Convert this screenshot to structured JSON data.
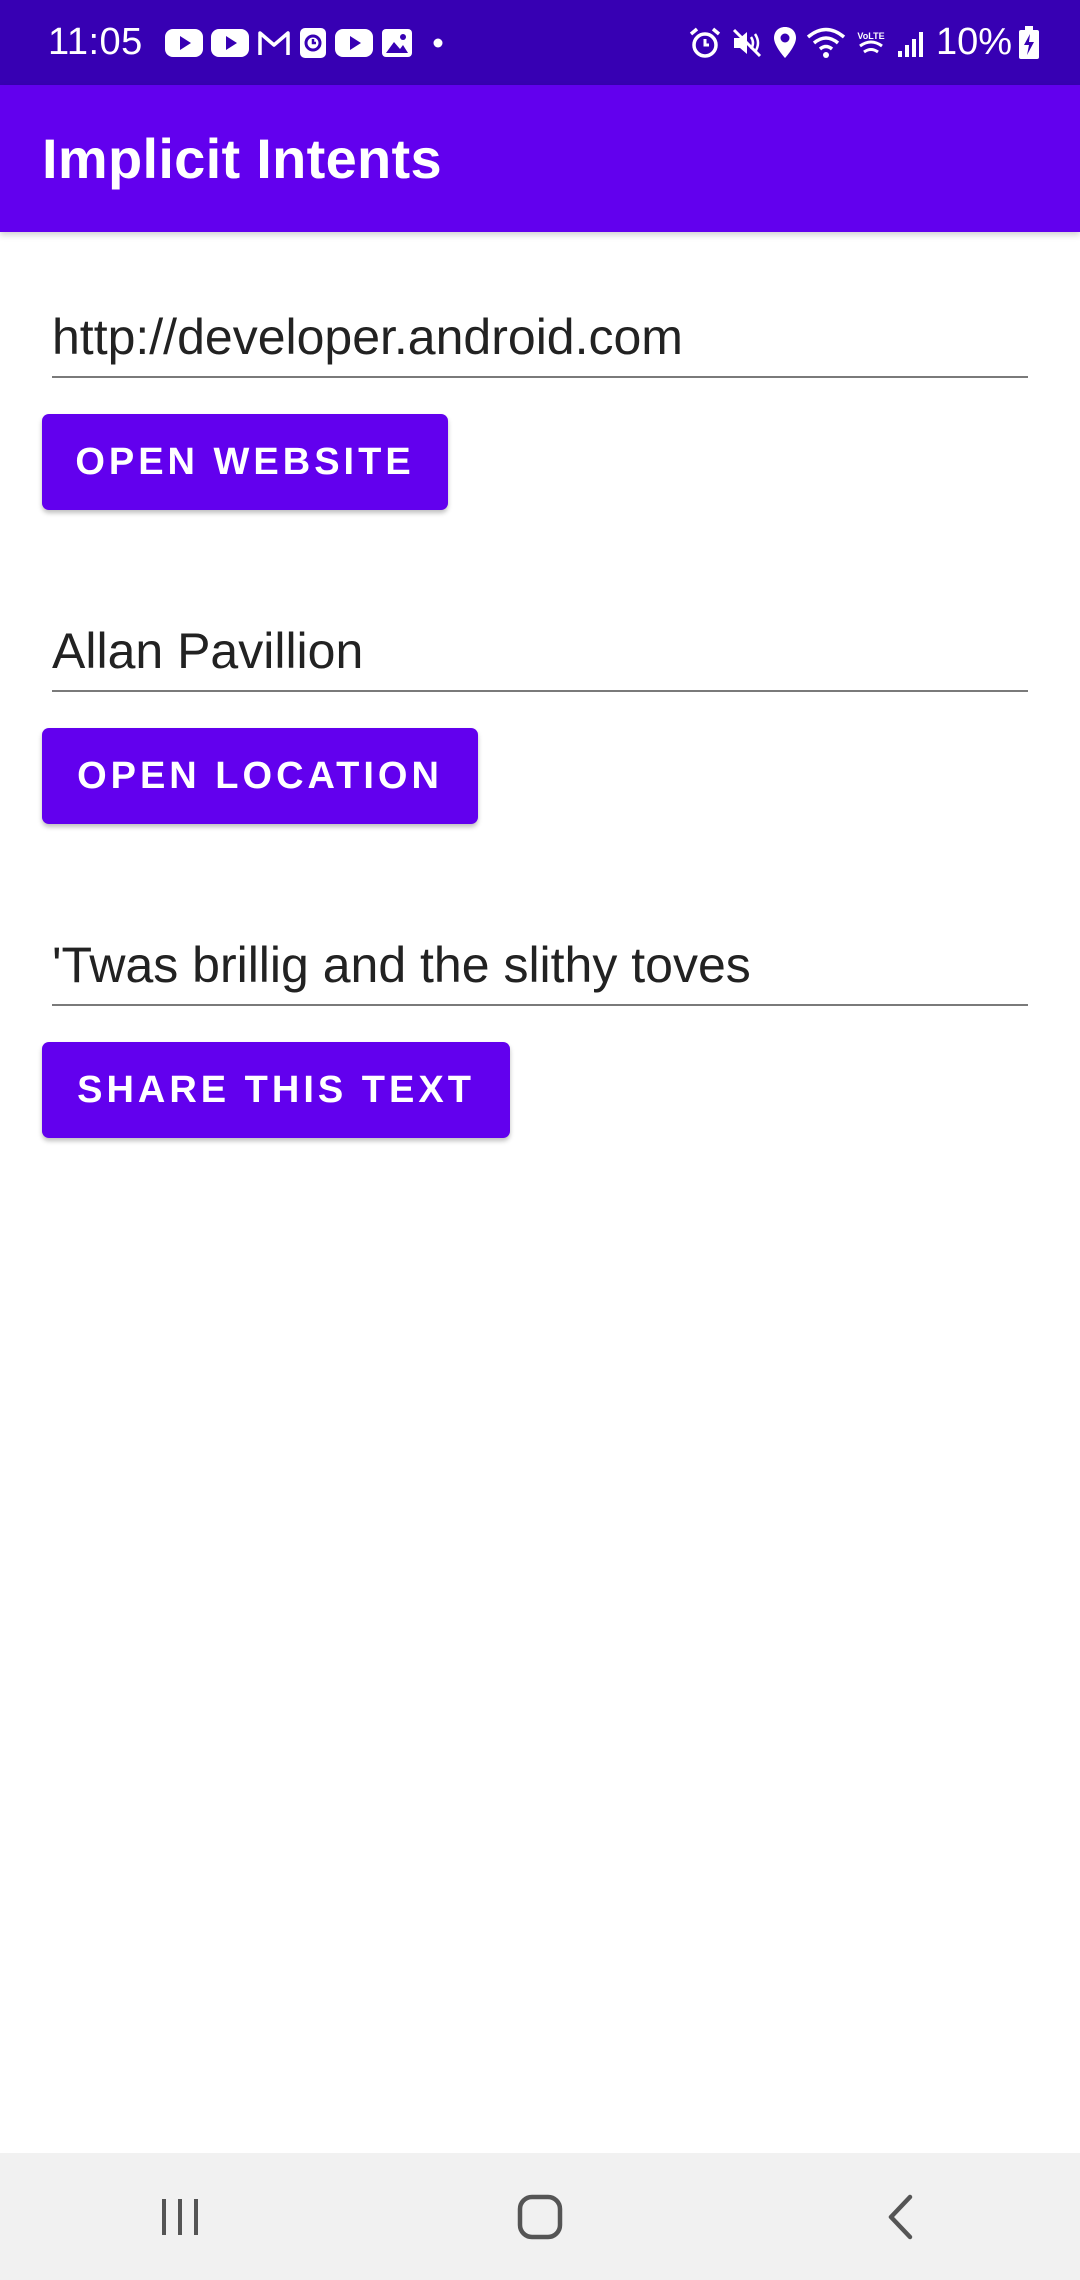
{
  "status_bar": {
    "time": "11:05",
    "battery": "10%",
    "notification_icons": [
      "youtube-icon",
      "youtube-icon",
      "gmail-icon",
      "clock-app-icon",
      "youtube-icon",
      "gallery-icon",
      "more-dot-icon"
    ],
    "system_icons": [
      "alarm-icon",
      "mute-icon",
      "location-icon",
      "wifi-icon",
      "volte-icon",
      "signal-icon",
      "battery-charging-icon"
    ],
    "background": "#3700b3"
  },
  "app_bar": {
    "title": "Implicit Intents",
    "background": "#6200ee"
  },
  "website": {
    "input_value": "http://developer.android.com",
    "button_label": "OPEN WEBSITE"
  },
  "location": {
    "input_value": "Allan Pavillion",
    "button_label": "OPEN LOCATION"
  },
  "share": {
    "input_value": "'Twas brillig and the slithy toves",
    "button_label": "SHARE THIS TEXT"
  },
  "nav_bar": {
    "buttons": [
      "recent-apps-icon",
      "home-icon",
      "back-icon"
    ],
    "background": "#f1f1f1"
  },
  "colors": {
    "accent": "#6200ee",
    "accent_dark": "#3700b3"
  }
}
